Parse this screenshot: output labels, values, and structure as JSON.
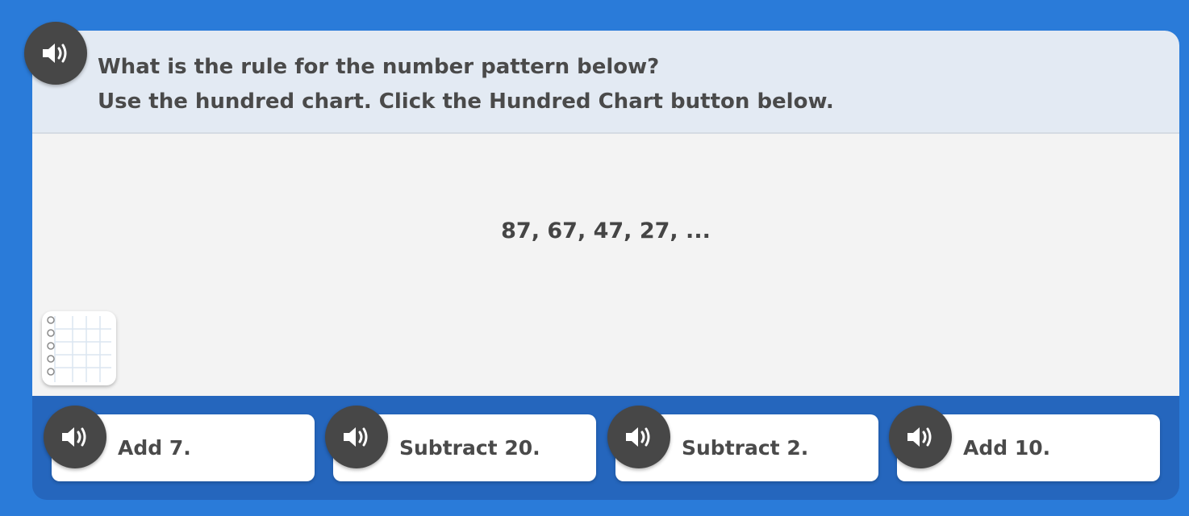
{
  "question": {
    "line1": "What is the rule for the number pattern below?",
    "line2": "Use the hundred chart. Click the Hundred Chart button below."
  },
  "pattern_text": "87, 67, 47, 27, ...",
  "icons": {
    "audio": "speaker-icon",
    "hundred_chart": "hundred-chart-notebook-icon"
  },
  "answers": [
    {
      "label": "Add 7."
    },
    {
      "label": "Subtract 20."
    },
    {
      "label": "Subtract 2."
    },
    {
      "label": "Add 10."
    }
  ],
  "colors": {
    "background": "#2a7bd9",
    "panel": "#2566bd",
    "header": "#e3eaf3",
    "work_area": "#f3f3f3",
    "audio_button": "#474747",
    "text": "#4a4a4a"
  }
}
